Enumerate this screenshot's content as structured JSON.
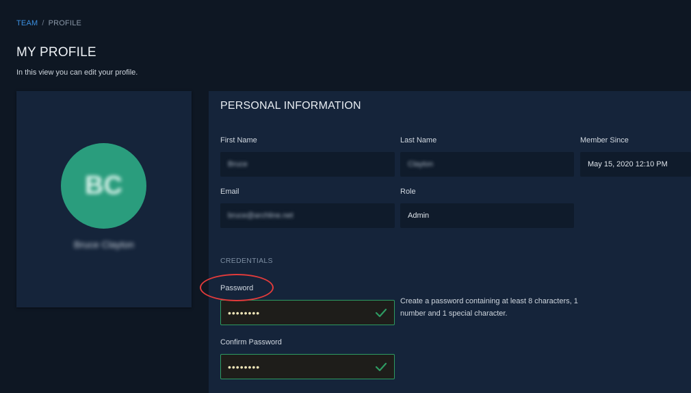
{
  "breadcrumb": {
    "team": "TEAM",
    "separator": "/",
    "current": "PROFILE"
  },
  "page": {
    "title": "MY PROFILE",
    "subtitle": "In this view you can edit your profile."
  },
  "avatar": {
    "initials": "BC",
    "name": "Bruce Clayton",
    "color": "#2a9d7d"
  },
  "personal_info": {
    "title": "PERSONAL INFORMATION",
    "first_name": {
      "label": "First Name",
      "value": "Bruce"
    },
    "last_name": {
      "label": "Last Name",
      "value": "Clayton"
    },
    "member_since": {
      "label": "Member Since",
      "value": "May 15, 2020 12:10 PM"
    },
    "email": {
      "label": "Email",
      "value": "bruce@archline.net"
    },
    "role": {
      "label": "Role",
      "value": "Admin"
    }
  },
  "credentials": {
    "title": "CREDENTIALS",
    "password": {
      "label": "Password",
      "value": "••••••••"
    },
    "confirm_password": {
      "label": "Confirm Password",
      "value": "••••••••"
    },
    "hint": "Create a password containing at least 8 characters, 1 number and 1 special character."
  },
  "colors": {
    "accent": "#3b8fe0",
    "valid": "#2e9c63",
    "annotation": "#e23b3b"
  },
  "icons": {
    "valid": "check-icon"
  }
}
